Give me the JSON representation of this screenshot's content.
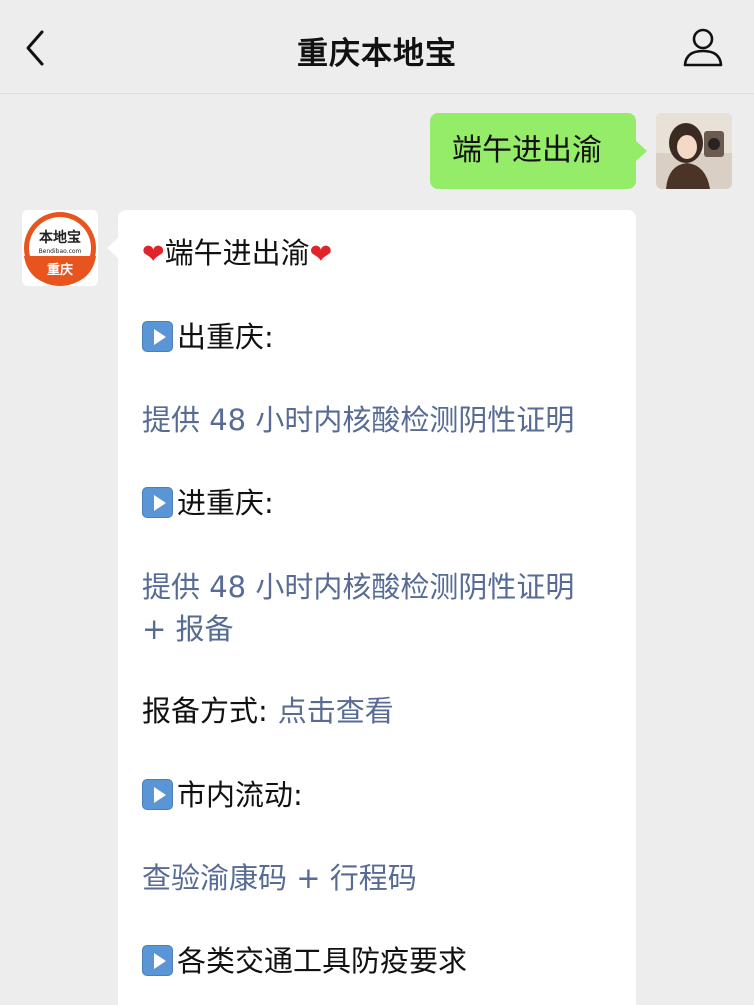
{
  "header": {
    "title": "重庆本地宝",
    "back_icon": "chevron-left-icon",
    "profile_icon": "person-icon"
  },
  "chat": {
    "my_message": "端午进出渝",
    "bot_avatar": {
      "logo_main": "本地宝",
      "logo_sub": "Bendibao.com",
      "logo_city": "重庆",
      "brand_color": "#e8541e"
    },
    "reply": {
      "title": "端午进出渝",
      "section1_head": "出重庆:",
      "section1_body": "提供 48 小时内核酸检测阴性证明",
      "section2_head": "进重庆:",
      "section2_body_line1": "提供 48 小时内核酸检测阴性证明",
      "section2_body_line2": "+ 报备",
      "report_label": "报备方式:",
      "report_link": "点击查看",
      "section3_head": "市内流动:",
      "section3_body": "查验渝康码 + 行程码",
      "section4_head": "各类交通工具防疫要求"
    }
  },
  "colors": {
    "my_bubble": "#95ec69",
    "link_blue": "#576b95",
    "play_icon_blue": "#5a96d6"
  }
}
